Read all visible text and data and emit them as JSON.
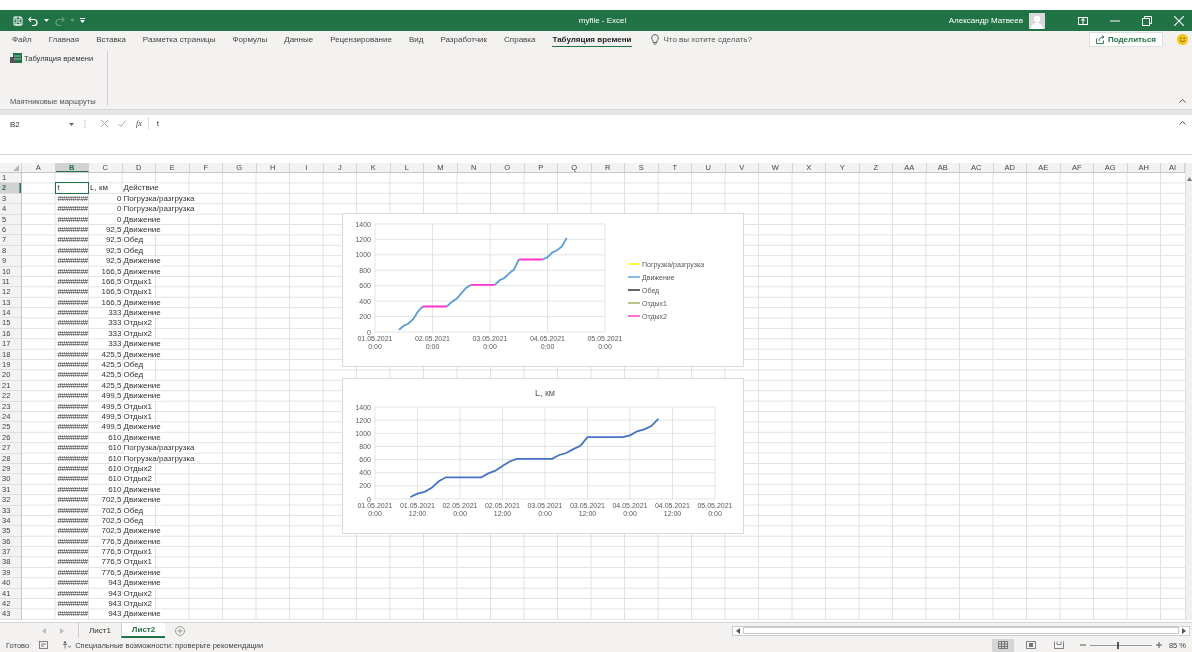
{
  "window": {
    "title": "myfile - Excel",
    "user": "Александр Матвеев"
  },
  "ribbon": {
    "tabs": [
      {
        "label": "Файл",
        "selected": false
      },
      {
        "label": "Главная",
        "selected": false
      },
      {
        "label": "Вставка",
        "selected": false
      },
      {
        "label": "Разметка страницы",
        "selected": false
      },
      {
        "label": "Формулы",
        "selected": false
      },
      {
        "label": "Данные",
        "selected": false
      },
      {
        "label": "Рецензирование",
        "selected": false
      },
      {
        "label": "Вид",
        "selected": false
      },
      {
        "label": "Разработчик",
        "selected": false
      },
      {
        "label": "Справка",
        "selected": false
      },
      {
        "label": "Табуляция времени",
        "selected": true
      }
    ],
    "tell_me": {
      "placeholder": "Что вы хотите сделать?"
    },
    "share_button": "Поделиться",
    "group": {
      "button": "Табуляция времени",
      "label": "Маятниковые маршруты"
    }
  },
  "formula_bar": {
    "name_box": "B2",
    "function_label": "fx",
    "formula": "t"
  },
  "grid": {
    "columns": [
      {
        "label": "A",
        "selected": false
      },
      {
        "label": "B",
        "selected": true
      },
      {
        "label": "C",
        "selected": false
      },
      {
        "label": "D",
        "selected": false
      },
      {
        "label": "E",
        "selected": false
      },
      {
        "label": "F",
        "selected": false
      },
      {
        "label": "G",
        "selected": false
      },
      {
        "label": "H",
        "selected": false
      },
      {
        "label": "I",
        "selected": false
      },
      {
        "label": "J",
        "selected": false
      },
      {
        "label": "K",
        "selected": false
      },
      {
        "label": "L",
        "selected": false
      },
      {
        "label": "M",
        "selected": false
      },
      {
        "label": "N",
        "selected": false
      },
      {
        "label": "O",
        "selected": false
      },
      {
        "label": "P",
        "selected": false
      },
      {
        "label": "Q",
        "selected": false
      },
      {
        "label": "R",
        "selected": false
      },
      {
        "label": "S",
        "selected": false
      },
      {
        "label": "T",
        "selected": false
      },
      {
        "label": "U",
        "selected": false
      },
      {
        "label": "V",
        "selected": false
      },
      {
        "label": "W",
        "selected": false
      },
      {
        "label": "X",
        "selected": false
      },
      {
        "label": "Y",
        "selected": false
      },
      {
        "label": "Z",
        "selected": false
      },
      {
        "label": "AA",
        "selected": false
      },
      {
        "label": "AB",
        "selected": false
      },
      {
        "label": "AC",
        "selected": false
      },
      {
        "label": "AD",
        "selected": false
      },
      {
        "label": "AE",
        "selected": false
      },
      {
        "label": "AF",
        "selected": false
      },
      {
        "label": "AG",
        "selected": false
      },
      {
        "label": "AH",
        "selected": false
      },
      {
        "label": "AI",
        "selected": false
      }
    ],
    "rows": [
      {
        "number": "1",
        "selected": false
      },
      {
        "number": "2",
        "selected": true,
        "kind": "header",
        "b": "t",
        "c": "L, км",
        "d": "Действие"
      },
      {
        "number": "3",
        "selected": false,
        "kind": "data",
        "b": "########",
        "c": "0",
        "d": "Погрузка/разгрузка"
      },
      {
        "number": "4",
        "selected": false,
        "kind": "data",
        "b": "########",
        "c": "0",
        "d": "Погрузка/разгрузка"
      },
      {
        "number": "5",
        "selected": false,
        "kind": "data",
        "b": "########",
        "c": "0",
        "d": "Движение"
      },
      {
        "number": "6",
        "selected": false,
        "kind": "data",
        "b": "########",
        "c": "92,5",
        "d": "Движение"
      },
      {
        "number": "7",
        "selected": false,
        "kind": "data",
        "b": "########",
        "c": "92,5",
        "d": "Обед"
      },
      {
        "number": "8",
        "selected": false,
        "kind": "data",
        "b": "########",
        "c": "92,5",
        "d": "Обед"
      },
      {
        "number": "9",
        "selected": false,
        "kind": "data",
        "b": "########",
        "c": "92,5",
        "d": "Движение"
      },
      {
        "number": "10",
        "selected": false,
        "kind": "data",
        "b": "########",
        "c": "166,5",
        "d": "Движение"
      },
      {
        "number": "11",
        "selected": false,
        "kind": "data",
        "b": "########",
        "c": "166,5",
        "d": "Отдых1"
      },
      {
        "number": "12",
        "selected": false,
        "kind": "data",
        "b": "########",
        "c": "166,5",
        "d": "Отдых1"
      },
      {
        "number": "13",
        "selected": false,
        "kind": "data",
        "b": "########",
        "c": "166,5",
        "d": "Движение"
      },
      {
        "number": "14",
        "selected": false,
        "kind": "data",
        "b": "########",
        "c": "333",
        "d": "Движение"
      },
      {
        "number": "15",
        "selected": false,
        "kind": "data",
        "b": "########",
        "c": "333",
        "d": "Отдых2"
      },
      {
        "number": "16",
        "selected": false,
        "kind": "data",
        "b": "########",
        "c": "333",
        "d": "Отдых2"
      },
      {
        "number": "17",
        "selected": false,
        "kind": "data",
        "b": "########",
        "c": "333",
        "d": "Движение"
      },
      {
        "number": "18",
        "selected": false,
        "kind": "data",
        "b": "########",
        "c": "425,5",
        "d": "Движение"
      },
      {
        "number": "19",
        "selected": false,
        "kind": "data",
        "b": "########",
        "c": "425,5",
        "d": "Обед"
      },
      {
        "number": "20",
        "selected": false,
        "kind": "data",
        "b": "########",
        "c": "425,5",
        "d": "Обед"
      },
      {
        "number": "21",
        "selected": false,
        "kind": "data",
        "b": "########",
        "c": "425,5",
        "d": "Движение"
      },
      {
        "number": "22",
        "selected": false,
        "kind": "data",
        "b": "########",
        "c": "499,5",
        "d": "Движение"
      },
      {
        "number": "23",
        "selected": false,
        "kind": "data",
        "b": "########",
        "c": "499,5",
        "d": "Отдых1"
      },
      {
        "number": "24",
        "selected": false,
        "kind": "data",
        "b": "########",
        "c": "499,5",
        "d": "Отдых1"
      },
      {
        "number": "25",
        "selected": false,
        "kind": "data",
        "b": "########",
        "c": "499,5",
        "d": "Движение"
      },
      {
        "number": "26",
        "selected": false,
        "kind": "data",
        "b": "########",
        "c": "610",
        "d": "Движение"
      },
      {
        "number": "27",
        "selected": false,
        "kind": "data",
        "b": "########",
        "c": "610",
        "d": "Погрузка/разгрузка"
      },
      {
        "number": "28",
        "selected": false,
        "kind": "data",
        "b": "########",
        "c": "610",
        "d": "Погрузка/разгрузка"
      },
      {
        "number": "29",
        "selected": false,
        "kind": "data",
        "b": "########",
        "c": "610",
        "d": "Отдых2"
      },
      {
        "number": "30",
        "selected": false,
        "kind": "data",
        "b": "########",
        "c": "610",
        "d": "Отдых2"
      },
      {
        "number": "31",
        "selected": false,
        "kind": "data",
        "b": "########",
        "c": "610",
        "d": "Движение"
      },
      {
        "number": "32",
        "selected": false,
        "kind": "data",
        "b": "########",
        "c": "702,5",
        "d": "Движение"
      },
      {
        "number": "33",
        "selected": false,
        "kind": "data",
        "b": "########",
        "c": "702,5",
        "d": "Обед"
      },
      {
        "number": "34",
        "selected": false,
        "kind": "data",
        "b": "########",
        "c": "702,5",
        "d": "Обед"
      },
      {
        "number": "35",
        "selected": false,
        "kind": "data",
        "b": "########",
        "c": "702,5",
        "d": "Движение"
      },
      {
        "number": "36",
        "selected": false,
        "kind": "data",
        "b": "########",
        "c": "776,5",
        "d": "Движение"
      },
      {
        "number": "37",
        "selected": false,
        "kind": "data",
        "b": "########",
        "c": "776,5",
        "d": "Отдых1"
      },
      {
        "number": "38",
        "selected": false,
        "kind": "data",
        "b": "########",
        "c": "776,5",
        "d": "Отдых1"
      },
      {
        "number": "39",
        "selected": false,
        "kind": "data",
        "b": "########",
        "c": "776,5",
        "d": "Движение"
      },
      {
        "number": "40",
        "selected": false,
        "kind": "data",
        "b": "########",
        "c": "943",
        "d": "Движение"
      },
      {
        "number": "41",
        "selected": false,
        "kind": "data",
        "b": "########",
        "c": "943",
        "d": "Отдых2"
      },
      {
        "number": "42",
        "selected": false,
        "kind": "data",
        "b": "########",
        "c": "943",
        "d": "Отдых2"
      },
      {
        "number": "43",
        "selected": false,
        "kind": "data",
        "b": "########",
        "c": "943",
        "d": "Движение"
      }
    ]
  },
  "charts": [
    {
      "chart_data": {
        "type": "line",
        "grid": true,
        "legend": true,
        "ylim": [
          0,
          1400
        ],
        "yticks": [
          0,
          200,
          400,
          600,
          800,
          1000,
          1200,
          1400
        ],
        "categories": [
          "01.05.2021 0:00",
          null,
          null,
          null,
          null,
          null,
          null,
          null,
          null,
          null,
          null,
          null,
          "02.05.2021 0:00",
          null,
          null,
          null,
          null,
          null,
          null,
          null,
          null,
          null,
          null,
          null,
          "03.05.2021 0:00",
          null,
          null,
          null,
          null,
          null,
          null,
          null,
          null,
          null,
          null,
          null,
          "04.05.2021 0:00",
          null,
          null,
          null,
          null,
          null,
          null,
          null,
          null,
          null,
          null,
          null,
          "05.05.2021 0:00"
        ],
        "series": [
          {
            "name": "Погрузка/разгрузка",
            "color": "#ffff00",
            "values": [
              null,
              null,
              null,
              null,
              null,
              null,
              null,
              null,
              null,
              null,
              null,
              null,
              null,
              null,
              null,
              null,
              null,
              null,
              null,
              null,
              null,
              null,
              null,
              null,
              null,
              null,
              null,
              null,
              null,
              null,
              null,
              null,
              null,
              null,
              null,
              null,
              null,
              null,
              null,
              null,
              null,
              null,
              null,
              null,
              null,
              null,
              null,
              null,
              null
            ]
          },
          {
            "name": "Движение",
            "color": "#5b9bd5",
            "values": [
              null,
              null,
              null,
              null,
              null,
              30,
              80,
              110,
              170,
              270,
              330,
              null,
              null,
              null,
              null,
              330,
              390,
              430,
              500,
              570,
              610,
              null,
              null,
              null,
              null,
              610,
              670,
              700,
              760,
              810,
              940,
              null,
              null,
              null,
              null,
              940,
              970,
              1030,
              1060,
              1110,
              1220,
              null,
              null,
              null,
              null,
              null,
              null,
              null,
              null
            ]
          },
          {
            "name": "Обед",
            "color": "#262626",
            "values": [
              null,
              null,
              null,
              null,
              null,
              null,
              null,
              null,
              null,
              null,
              null,
              null,
              null,
              null,
              null,
              null,
              null,
              null,
              null,
              null,
              null,
              null,
              null,
              null,
              null,
              null,
              null,
              null,
              null,
              null,
              null,
              null,
              null,
              null,
              null,
              null,
              null,
              null,
              null,
              null,
              null,
              null,
              null,
              null,
              null,
              null,
              null,
              null,
              null
            ]
          },
          {
            "name": "Отдых1",
            "color": "#a5a55a",
            "values": [
              null,
              null,
              null,
              null,
              null,
              null,
              null,
              null,
              null,
              null,
              null,
              null,
              null,
              null,
              null,
              null,
              null,
              null,
              null,
              null,
              null,
              null,
              null,
              null,
              null,
              null,
              null,
              null,
              null,
              null,
              null,
              null,
              null,
              null,
              null,
              null,
              null,
              null,
              null,
              null,
              null,
              null,
              null,
              null,
              null,
              null,
              null,
              null,
              null
            ]
          },
          {
            "name": "Отдых2",
            "color": "#ff33cc",
            "values": [
              null,
              null,
              null,
              null,
              null,
              null,
              null,
              null,
              null,
              null,
              330,
              330,
              330,
              330,
              330,
              330,
              null,
              null,
              null,
              null,
              610,
              610,
              610,
              610,
              610,
              610,
              null,
              null,
              null,
              null,
              940,
              940,
              940,
              940,
              940,
              940,
              null,
              null,
              null,
              null,
              null,
              null,
              null,
              null,
              null,
              null,
              null,
              null,
              null
            ]
          }
        ]
      }
    },
    {
      "chart_data": {
        "type": "line",
        "grid": true,
        "title": "L, км",
        "ylim": [
          0,
          1400
        ],
        "yticks": [
          0,
          200,
          400,
          600,
          800,
          1000,
          1200,
          1400
        ],
        "categories": [
          "01.05.2021 0:00",
          null,
          null,
          null,
          null,
          null,
          "01.05.2021 12:00",
          null,
          null,
          null,
          null,
          null,
          "02.05.2021 0:00",
          null,
          null,
          null,
          null,
          null,
          "02.05.2021 12:00",
          null,
          null,
          null,
          null,
          null,
          "03.05.2021 0:00",
          null,
          null,
          null,
          null,
          null,
          "03.05.2021 12:00",
          null,
          null,
          null,
          null,
          null,
          "04.05.2021 0:00",
          null,
          null,
          null,
          null,
          null,
          "04.05.2021 12:00",
          null,
          null,
          null,
          null,
          null,
          "05.05.2021 0:00"
        ],
        "series": [
          {
            "color": "#4472c4",
            "values": [
              null,
              null,
              null,
              null,
              null,
              30,
              80,
              110,
              170,
              270,
              330,
              330,
              330,
              330,
              330,
              330,
              390,
              430,
              500,
              570,
              610,
              610,
              610,
              610,
              610,
              610,
              670,
              700,
              760,
              810,
              940,
              940,
              940,
              940,
              940,
              940,
              970,
              1030,
              1060,
              1110,
              1220,
              null,
              null,
              null,
              null,
              null,
              null,
              null,
              null
            ]
          }
        ]
      }
    }
  ],
  "sheet_tabs": [
    {
      "label": "Лист1",
      "selected": false
    },
    {
      "label": "Лист2",
      "selected": true
    }
  ],
  "status_bar": {
    "ready": "Готово",
    "accessibility": "Специальные возможности: проверьте рекомендации",
    "views": [
      {
        "kind": "normal",
        "selected": true
      },
      {
        "kind": "page_layout",
        "selected": false
      },
      {
        "kind": "page_break",
        "selected": false
      }
    ],
    "zoom": {
      "level": 0.45,
      "reading": "85 %"
    }
  }
}
